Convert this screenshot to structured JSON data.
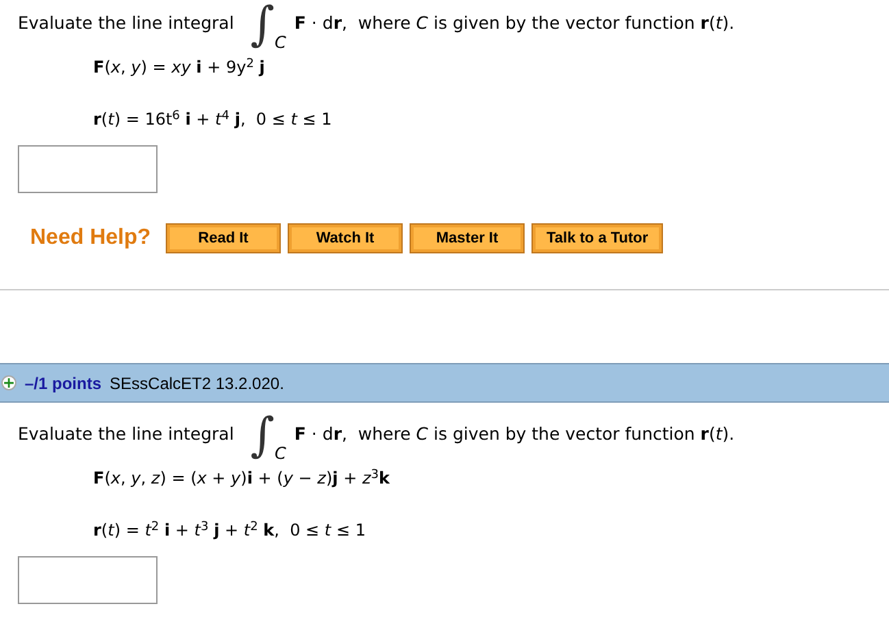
{
  "problems": [
    {
      "intro": {
        "before": "Evaluate the line integral",
        "integral": "∫",
        "subscript": "C",
        "after": "**F** · d**r**,  where *C* is given by the vector function **r**(*t*)."
      },
      "equations": [
        "**F**(*x*, *y*) = *xy* **i** + 9y$^{2}$ **j**",
        "**r**(*t*) = 16t$^{6}$ **i** + *t*$^{4}$ **j**,  0 ≤ *t* ≤ 1"
      ],
      "help": {
        "label": "Need Help?",
        "buttons": [
          "Read It",
          "Watch It",
          "Master It",
          "Talk to a Tutor"
        ]
      }
    },
    {
      "header": {
        "expand": "+",
        "points": "–/1 points",
        "source": "SEssCalcET2 13.2.020."
      },
      "intro": {
        "before": "Evaluate the line integral",
        "integral": "∫",
        "subscript": "C",
        "after": "**F** · d**r**,  where *C* is given by the vector function **r**(*t*)."
      },
      "equations": [
        "**F**(*x*, *y*, *z*) = (*x* + *y*)**i** + (*y* − *z*)**j** + *z*$^{3}$**k**",
        "**r**(*t*) = *t*$^{2}$ **i** + *t*$^{3}$ **j** + *t*$^{2}$ **k**,  0 ≤ *t* ≤ 1"
      ]
    }
  ]
}
